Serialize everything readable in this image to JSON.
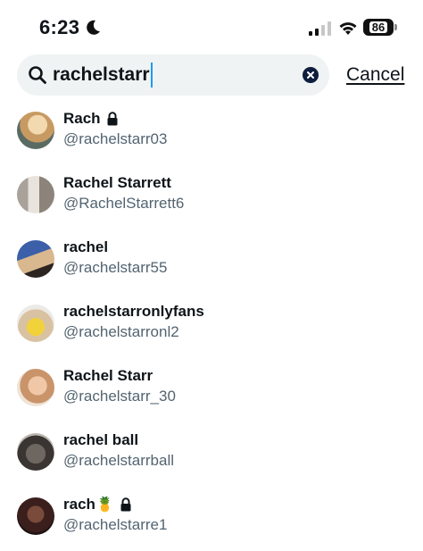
{
  "status_bar": {
    "time": "6:23",
    "battery": "86"
  },
  "search": {
    "query": "rachelstarr",
    "cancel_label": "Cancel"
  },
  "results": [
    {
      "name": "Rach",
      "handle": "@rachelstarr03",
      "locked": true,
      "emoji": ""
    },
    {
      "name": "Rachel Starrett",
      "handle": "@RachelStarrett6",
      "locked": false,
      "emoji": ""
    },
    {
      "name": "rachel",
      "handle": "@rachelstarr55",
      "locked": false,
      "emoji": ""
    },
    {
      "name": "rachelstarronlyfans",
      "handle": "@rachelstarronl2",
      "locked": false,
      "emoji": ""
    },
    {
      "name": "Rachel Starr",
      "handle": "@rachelstarr_30",
      "locked": false,
      "emoji": ""
    },
    {
      "name": "rachel ball",
      "handle": "@rachelstarrball",
      "locked": false,
      "emoji": ""
    },
    {
      "name": "rach",
      "handle": "@rachelstarre1",
      "locked": true,
      "emoji": "🍍"
    }
  ],
  "colors": {
    "accent": "#1d9bf0",
    "search_bg": "#eff3f4",
    "secondary_text": "#536471",
    "primary_text": "#0f1419"
  }
}
